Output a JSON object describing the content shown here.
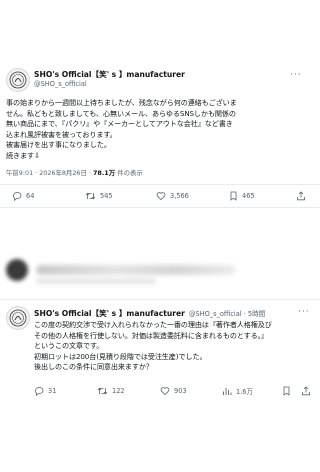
{
  "tweet1": {
    "name": "SHO's Official【笑' s 】manufacturer",
    "handle": "@SHO_s_official",
    "lines": [
      "事の始まりから一週間以上待ちましたが、残念ながら何の連絡もございま",
      "せん。私どもと致しましても、心無いメール、あらゆるSNSしかも関係の",
      "無い商品にまで、『パクリ』や『メーカーとしてアウトな会社』など書き",
      "込まれ風評被害を被っております。",
      "被害届けを出す事になりました。",
      "続きます⇩"
    ],
    "time": "午前9:01 · 2026年8月26日 · ",
    "views_count": "78.1万",
    "views_label": " 件の表示",
    "replies": "64",
    "reposts": "545",
    "likes": "3,566",
    "bookmarks": "465"
  },
  "tweet2": {
    "name": "SHO's Official【笑' s 】manufacturer",
    "handle": "@SHO_s_official · 5時間",
    "lines": [
      "この度の契約交渉で受け入れられなかった一番の理由は『著作者人格権及び",
      "その他の人格権を行使しない。対価は製造委託料に含まれるものとする。』",
      "というこの文章です。",
      "初期ロットは200台(見積り段階では受注生産)でした。",
      "後出しのこの条件に同意出来ますか？"
    ],
    "replies": "31",
    "reposts": "122",
    "likes": "903",
    "views": "1.6万"
  },
  "colors": {
    "accent": "#1d9bf0",
    "muted": "#536471",
    "text": "#0f1419"
  }
}
